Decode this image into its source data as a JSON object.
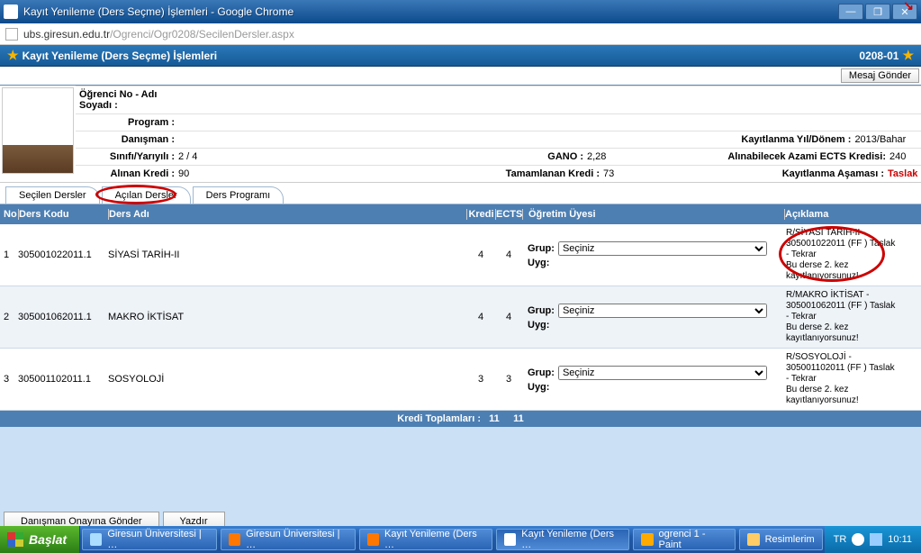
{
  "window": {
    "title": "Kayıt Yenileme (Ders Seçme) İşlemleri - Google Chrome",
    "min": "—",
    "max": "❐",
    "close": "✕"
  },
  "address": {
    "host": "ubs.giresun.edu.tr",
    "path": "/Ogrenci/Ogr0208/SecilenDersler.aspx"
  },
  "bluebar": {
    "title": "Kayıt Yenileme (Ders Seçme) İşlemleri",
    "code": "0208-01"
  },
  "mesaj": "Mesaj Gönder",
  "profile": {
    "ogrenci_no_lbl": "Öğrenci No - Adı Soyadı :",
    "ogrenci_no_val": "",
    "program_lbl": "Program :",
    "program_val": "",
    "danisman_lbl": "Danışman :",
    "danisman_val": "",
    "sinif_lbl": "Sınıfı/Yarıyılı :",
    "sinif_val": "2 / 4",
    "gano_lbl": "GANO :",
    "gano_val": "2,28",
    "yil_lbl": "Kayıtlanma Yıl/Dönem :",
    "yil_val": "2013/Bahar",
    "alinan_lbl": "Alınan Kredi :",
    "alinan_val": "90",
    "tamam_lbl": "Tamamlanan Kredi :",
    "tamam_val": "73",
    "ects_lbl": "Alınabilecek Azami ECTS Kredisi:",
    "ects_val": "240",
    "asama_lbl": "Kayıtlanma Aşaması :",
    "asama_val": "Taslak"
  },
  "tabs": {
    "t1": "Seçilen Dersler",
    "t2": "Açılan Dersler",
    "t3": "Ders Programı"
  },
  "headers": {
    "no": "No",
    "kodu": "Ders Kodu",
    "adi": "Ders Adı",
    "kredi": "Kredi",
    "ects": "ECTS",
    "ogr": "Öğretim Üyesi",
    "acik": "Açıklama"
  },
  "rows": [
    {
      "no": "1",
      "kodu": "305001022011.1",
      "adi": "SİYASİ TARİH-II",
      "kredi": "4",
      "ects": "4",
      "grup_lbl": "Grup:",
      "grup_opt": "Seçiniz",
      "uyg_lbl": "Uyg:",
      "acik": "R/SİYASİ TARİH-II - 305001022011 (FF ) Taslak - Tekrar\nBu derse 2. kez kayıtlanıyorsunuz!"
    },
    {
      "no": "2",
      "kodu": "305001062011.1",
      "adi": "MAKRO İKTİSAT",
      "kredi": "4",
      "ects": "4",
      "grup_lbl": "Grup:",
      "grup_opt": "Seçiniz",
      "uyg_lbl": "Uyg:",
      "acik": "R/MAKRO İKTİSAT - 305001062011 (FF ) Taslak - Tekrar\nBu derse 2. kez kayıtlanıyorsunuz!"
    },
    {
      "no": "3",
      "kodu": "305001102011.1",
      "adi": "SOSYOLOJİ",
      "kredi": "3",
      "ects": "3",
      "grup_lbl": "Grup:",
      "grup_opt": "Seçiniz",
      "uyg_lbl": "Uyg:",
      "acik": "R/SOSYOLOJİ - 305001102011 (FF ) Taslak - Tekrar\nBu derse 2. kez kayıtlanıyorsunuz!"
    }
  ],
  "totals": {
    "label": "Kredi Toplamları :",
    "kredi": "11",
    "ects": "11"
  },
  "buttons": {
    "onay": "Danışman Onayına Gönder",
    "yazdir": "Yazdır"
  },
  "taskbar": {
    "start": "Başlat",
    "items": [
      "Giresun Üniversitesi | …",
      "Giresun Üniversitesi | …",
      "Kayıt Yenileme (Ders …",
      "Kayıt Yenileme (Ders …",
      "ogrenci 1 - Paint",
      "Resimlerim"
    ],
    "lang": "TR",
    "time": "10:11"
  }
}
